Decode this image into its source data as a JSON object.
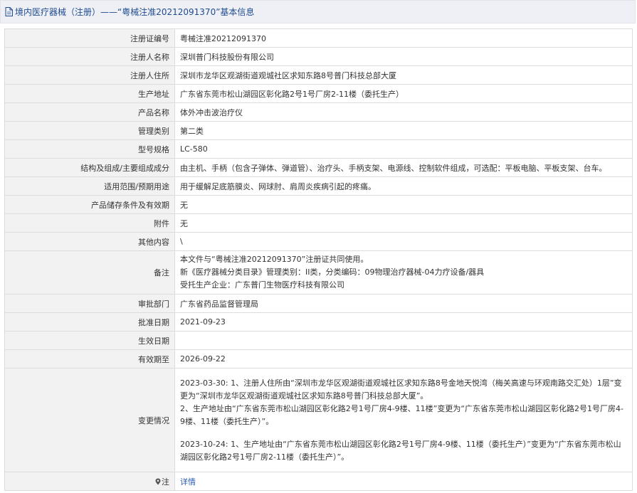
{
  "header": {
    "title": "境内医疗器械（注册）——“粤械注准20212091370”基本信息"
  },
  "rows": [
    {
      "label": "注册证编号",
      "value": "粤械注准20212091370"
    },
    {
      "label": "注册人名称",
      "value": "深圳普门科技股份有限公司"
    },
    {
      "label": "注册人住所",
      "value": "深圳市龙华区观湖街道观城社区求知东路8号普门科技总部大厦"
    },
    {
      "label": "生产地址",
      "value": "广东省东莞市松山湖园区彰化路2号1号厂房2-11楼（委托生产）"
    },
    {
      "label": "产品名称",
      "value": "体外冲击波治疗仪"
    },
    {
      "label": "管理类别",
      "value": "第二类"
    },
    {
      "label": "型号规格",
      "value": "LC-580"
    },
    {
      "label": "结构及组成/主要组成成分",
      "value": "由主机、手柄（包含子弹体、弹道管）、治疗头、手柄支架、电源线、控制软件组成，可选配：平板电脑、平板支架、台车。"
    },
    {
      "label": "适用范围/预期用途",
      "value": "用于缓解足底筋膜炎、网球肘、肩周炎疾病引起的疼痛。"
    },
    {
      "label": "产品储存条件及有效期",
      "value": "无"
    },
    {
      "label": "附件",
      "value": "无"
    },
    {
      "label": "其他内容",
      "value": "\\"
    },
    {
      "label": "备注",
      "lines": [
        "本文件与“粤械注准20212091370”注册证共同使用。",
        "新《医疗器械分类目录》管理类别：II类，分类编码：09物理治疗器械-04力疗设备/器具",
        "受托生产企业：广东普门生物医疗科技有限公司"
      ]
    },
    {
      "label": "审批部门",
      "value": "广东省药品监督管理局"
    },
    {
      "label": "批准日期",
      "value": "2021-09-23"
    },
    {
      "label": "生效日期",
      "value": ""
    },
    {
      "label": "有效期至",
      "value": "2026-09-22"
    },
    {
      "label": "变更情况",
      "paras": [
        "2023-03-30: 1、注册人住所由“深圳市龙华区观湖街道观城社区求知东路8号金地天悦湾（梅关高速与环观南路交汇处）1层”变更为“深圳市龙华区观湖街道观城社区求知东路8号普门科技总部大厦”。",
        "2、生产地址由“广东省东莞市松山湖园区彰化路2号1号厂房4-9楼、11楼”变更为“广东省东莞市松山湖园区彰化路2号1号厂房4-9楼、11楼（委托生产）”。",
        "2023-10-24: 1、生产地址由“广东省东莞市松山湖园区彰化路2号1号厂房4-9楼、11楼（委托生产）”变更为“广东省东莞市松山湖园区彰化路2号1号厂房2-11楼（委托生产）”。"
      ]
    },
    {
      "label": "注",
      "value": "详情"
    }
  ],
  "icons": {
    "title_icon": "document-icon",
    "note_icon": "pin-icon"
  },
  "colors": {
    "title_text": "#1f4b8f",
    "link": "#2a5db0",
    "label_bg": "#f2f2f2"
  }
}
